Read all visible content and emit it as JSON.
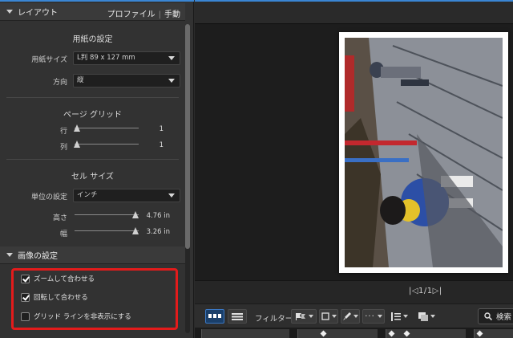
{
  "layout_panel": {
    "title": "レイアウト",
    "link_profile": "プロファイル",
    "link_manual": "手動"
  },
  "paper_settings": {
    "title": "用紙の設定",
    "paper_size_label": "用紙サイズ",
    "paper_size_value": "L判 89 x 127 mm",
    "orientation_label": "方向",
    "orientation_value": "縦"
  },
  "page_grid": {
    "title": "ページ グリッド",
    "rows_label": "行",
    "rows_value": "1",
    "cols_label": "列",
    "cols_value": "1"
  },
  "cell_size": {
    "title": "セル サイズ",
    "unit_label": "単位の設定",
    "unit_value": "インチ",
    "height_label": "高さ",
    "height_value": "4.76 in",
    "width_label": "幅",
    "width_value": "3.26 in"
  },
  "image_settings": {
    "title": "画像の設定",
    "options": [
      {
        "label": "ズームして合わせる",
        "checked": true
      },
      {
        "label": "回転して合わせる",
        "checked": true
      },
      {
        "label": "グリッド ラインを非表示にする",
        "checked": false
      }
    ]
  },
  "preview": {
    "pager": "|◁1/1▷|"
  },
  "toolbar": {
    "filter_label": "フィルター:",
    "search_label": "検索"
  },
  "colors": {
    "accent": "#3a86d4",
    "highlight": "#e31b1b"
  }
}
